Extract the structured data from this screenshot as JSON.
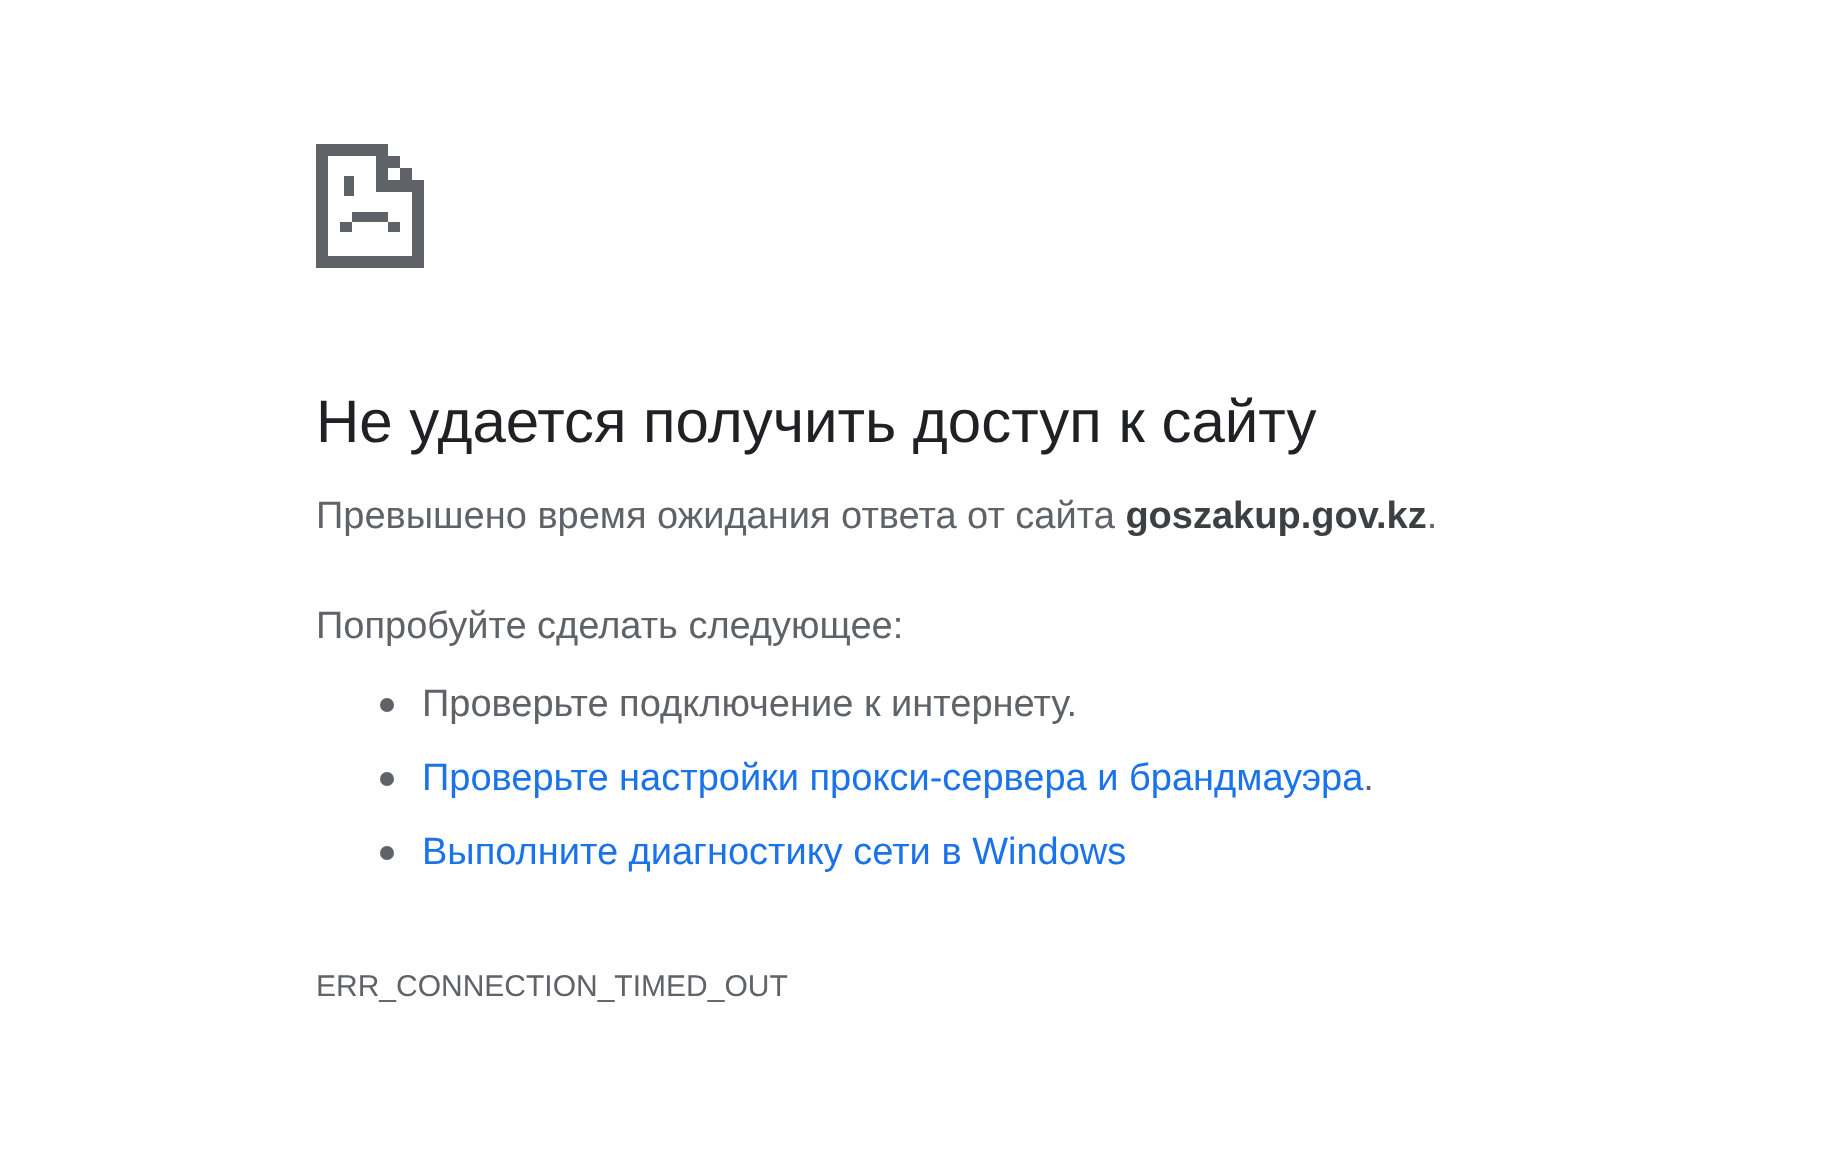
{
  "heading": "Не удается получить доступ к сайту",
  "summary": "Превышено время ожидания ответа от сайта **goszakup.gov.kz**.",
  "suggestions_heading": "Попробуйте сделать следующее:",
  "suggestions": [
    {
      "kind": "text",
      "text": "Проверьте подключение к интернету."
    },
    {
      "kind": "link",
      "text": "Проверьте настройки прокси-сервера и брандмауэра",
      "suffix": "."
    },
    {
      "kind": "link",
      "text": "Выполните диагностику сети в Windows"
    }
  ],
  "error_code": "ERR_CONNECTION_TIMED_OUT"
}
